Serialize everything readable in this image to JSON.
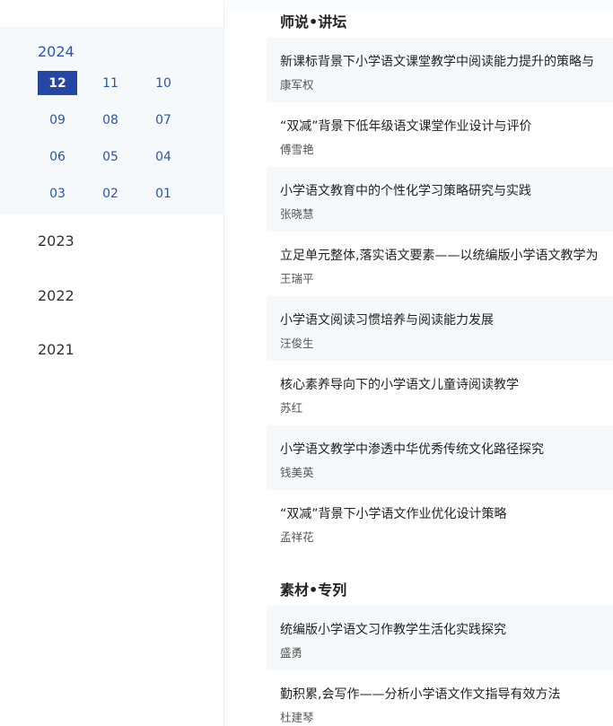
{
  "sidebar": {
    "active_year": "2024",
    "months": [
      {
        "label": "12",
        "active": true
      },
      {
        "label": "11",
        "active": false
      },
      {
        "label": "10",
        "active": false
      },
      {
        "label": "09",
        "active": false
      },
      {
        "label": "08",
        "active": false
      },
      {
        "label": "07",
        "active": false
      },
      {
        "label": "06",
        "active": false
      },
      {
        "label": "05",
        "active": false
      },
      {
        "label": "04",
        "active": false
      },
      {
        "label": "03",
        "active": false
      },
      {
        "label": "02",
        "active": false
      },
      {
        "label": "01",
        "active": false
      }
    ],
    "other_years": [
      "2023",
      "2022",
      "2021"
    ]
  },
  "sections": [
    {
      "title": "师说•讲坛",
      "articles": [
        {
          "title": "新课标背景下小学语文课堂教学中阅读能力提升的策略与",
          "author": "康军权"
        },
        {
          "title": "“双减”背景下低年级语文课堂作业设计与评价",
          "author": "傅雪艳"
        },
        {
          "title": "小学语文教育中的个性化学习策略研究与实践",
          "author": "张晓慧"
        },
        {
          "title": "立足单元整体,落实语文要素——以统编版小学语文教学为",
          "author": "王瑞平"
        },
        {
          "title": "小学语文阅读习惯培养与阅读能力发展",
          "author": "汪俊生"
        },
        {
          "title": "核心素养导向下的小学语文儿童诗阅读教学",
          "author": "苏红"
        },
        {
          "title": "小学语文教学中渗透中华优秀传统文化路径探究",
          "author": "钱美英"
        },
        {
          "title": "“双减”背景下小学语文作业优化设计策略",
          "author": "孟祥花"
        }
      ]
    },
    {
      "title": "素材•专列",
      "articles": [
        {
          "title": "统编版小学语文习作教学生活化实践探究",
          "author": "盛勇"
        },
        {
          "title": "勤积累,会写作——分析小学语文作文指导有效方法",
          "author": "杜建琴"
        }
      ]
    }
  ],
  "colors": {
    "accent": "#2447a6",
    "link": "#2c56a8",
    "shade": "#f6f9fc"
  }
}
